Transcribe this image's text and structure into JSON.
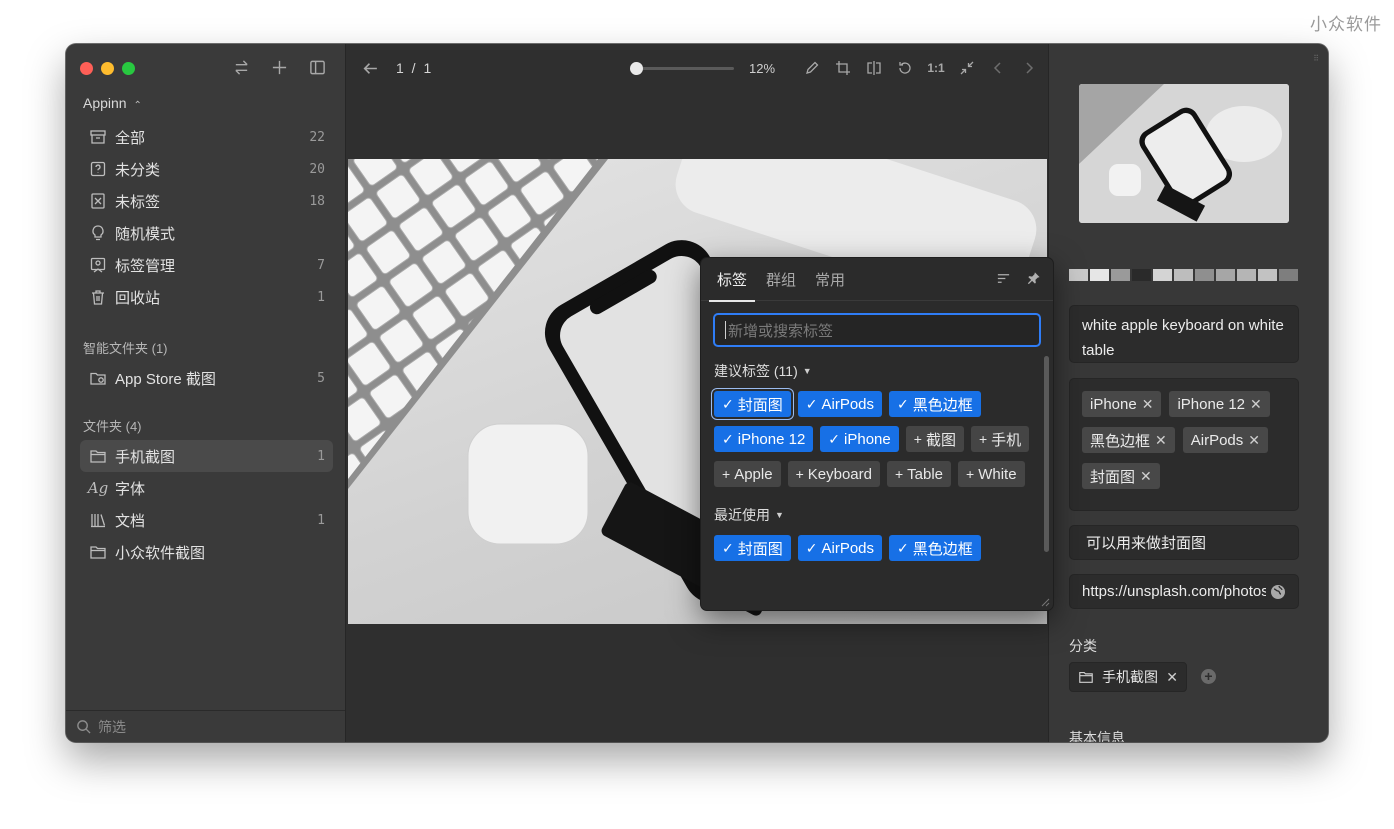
{
  "watermark": "小众软件",
  "sidebar": {
    "library": "Appinn",
    "items": [
      {
        "label": "全部",
        "count": "22",
        "icon": "archive-icon"
      },
      {
        "label": "未分类",
        "count": "20",
        "icon": "question-box-icon"
      },
      {
        "label": "未标签",
        "count": "18",
        "icon": "untagged-icon"
      },
      {
        "label": "随机模式",
        "count": "",
        "icon": "bulb-icon"
      },
      {
        "label": "标签管理",
        "count": "7",
        "icon": "tag-manage-icon"
      },
      {
        "label": "回收站",
        "count": "1",
        "icon": "trash-icon"
      }
    ],
    "smart_header": "智能文件夹 (1)",
    "smart_items": [
      {
        "label": "App Store 截图",
        "count": "5",
        "icon": "smart-folder-icon"
      }
    ],
    "folders_header": "文件夹 (4)",
    "folders": [
      {
        "label": "手机截图",
        "count": "1",
        "icon": "folder-icon",
        "active": true
      },
      {
        "label": "字体",
        "count": "",
        "icon": "font-icon"
      },
      {
        "label": "文档",
        "count": "1",
        "icon": "books-icon"
      },
      {
        "label": "小众软件截图",
        "count": "",
        "icon": "folder-icon"
      }
    ],
    "filter_placeholder": "筛选"
  },
  "toolbar": {
    "pager": "1 / 1",
    "zoom_label": "12%",
    "zoom_fraction": 0.02
  },
  "tag_popover": {
    "tabs": [
      "标签",
      "群组",
      "常用"
    ],
    "input_placeholder": "新增或搜索标签",
    "suggested_header": "建议标签 (11)",
    "suggested": [
      {
        "label": "封面图",
        "selected": true,
        "focus": true
      },
      {
        "label": "AirPods",
        "selected": true
      },
      {
        "label": "黑色边框",
        "selected": true
      },
      {
        "label": "iPhone 12",
        "selected": true
      },
      {
        "label": "iPhone",
        "selected": true
      },
      {
        "label": "截图",
        "selected": false
      },
      {
        "label": "手机",
        "selected": false
      },
      {
        "label": "Apple",
        "selected": false
      },
      {
        "label": "Keyboard",
        "selected": false
      },
      {
        "label": "Table",
        "selected": false
      },
      {
        "label": "White",
        "selected": false
      }
    ],
    "recent_header": "最近使用",
    "recent": [
      {
        "label": "封面图",
        "selected": true
      },
      {
        "label": "AirPods",
        "selected": true
      },
      {
        "label": "黑色边框",
        "selected": true
      }
    ]
  },
  "inspector": {
    "palette": [
      "#c9c9c9",
      "#e6e6e6",
      "#9a9a9a",
      "#2a2a2a",
      "#d4d4d4",
      "#bdbdbd",
      "#8f8f8f",
      "#a6a6a6",
      "#b5b5b5",
      "#c2c2c2",
      "#7e7e7e"
    ],
    "title": "white apple keyboard on white table",
    "tags": [
      "iPhone",
      "iPhone 12",
      "黑色边框",
      "AirPods",
      "封面图"
    ],
    "note": "可以用来做封面图",
    "url": "https://unsplash.com/photos/",
    "category_label": "分类",
    "category": "手机截图",
    "basic_info_label": "基本信息"
  }
}
